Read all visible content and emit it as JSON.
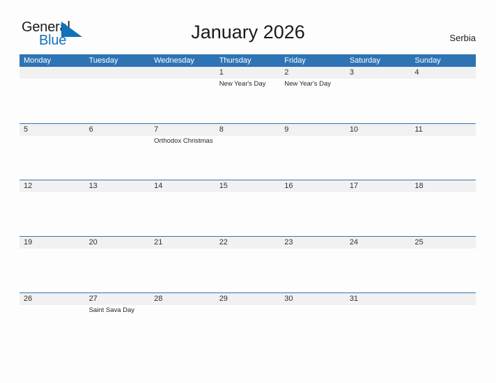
{
  "brand": {
    "name_part1": "General",
    "name_part2": "Blue",
    "sail_icon": "sail-triangle-icon",
    "accent_color": "#1171ba"
  },
  "header": {
    "title": "January 2026",
    "country": "Serbia"
  },
  "theme": {
    "header_blue": "#2e74b5",
    "band_grey": "#f1f1f1",
    "page_background": "#fdfdfd",
    "text_dark": "#1a1a1a"
  },
  "calendar": {
    "weekdays": [
      "Monday",
      "Tuesday",
      "Wednesday",
      "Thursday",
      "Friday",
      "Saturday",
      "Sunday"
    ],
    "weeks": [
      [
        {
          "day": "",
          "events": []
        },
        {
          "day": "",
          "events": []
        },
        {
          "day": "",
          "events": []
        },
        {
          "day": "1",
          "events": [
            "New Year's Day"
          ]
        },
        {
          "day": "2",
          "events": [
            "New Year's Day"
          ]
        },
        {
          "day": "3",
          "events": []
        },
        {
          "day": "4",
          "events": []
        }
      ],
      [
        {
          "day": "5",
          "events": []
        },
        {
          "day": "6",
          "events": []
        },
        {
          "day": "7",
          "events": [
            "Orthodox Christmas"
          ]
        },
        {
          "day": "8",
          "events": []
        },
        {
          "day": "9",
          "events": []
        },
        {
          "day": "10",
          "events": []
        },
        {
          "day": "11",
          "events": []
        }
      ],
      [
        {
          "day": "12",
          "events": []
        },
        {
          "day": "13",
          "events": []
        },
        {
          "day": "14",
          "events": []
        },
        {
          "day": "15",
          "events": []
        },
        {
          "day": "16",
          "events": []
        },
        {
          "day": "17",
          "events": []
        },
        {
          "day": "18",
          "events": []
        }
      ],
      [
        {
          "day": "19",
          "events": []
        },
        {
          "day": "20",
          "events": []
        },
        {
          "day": "21",
          "events": []
        },
        {
          "day": "22",
          "events": []
        },
        {
          "day": "23",
          "events": []
        },
        {
          "day": "24",
          "events": []
        },
        {
          "day": "25",
          "events": []
        }
      ],
      [
        {
          "day": "26",
          "events": []
        },
        {
          "day": "27",
          "events": [
            "Saint Sava Day"
          ]
        },
        {
          "day": "28",
          "events": []
        },
        {
          "day": "29",
          "events": []
        },
        {
          "day": "30",
          "events": []
        },
        {
          "day": "31",
          "events": []
        },
        {
          "day": "",
          "events": []
        }
      ]
    ]
  }
}
